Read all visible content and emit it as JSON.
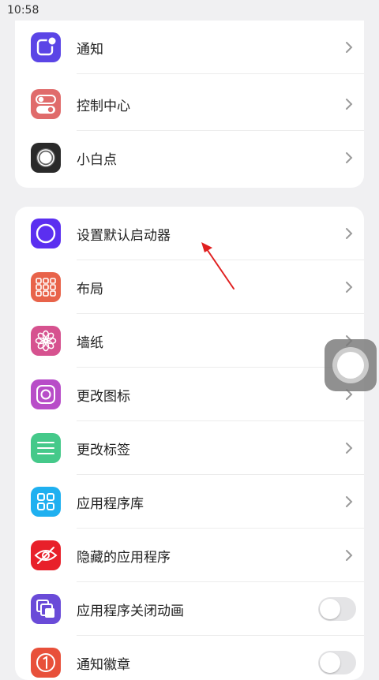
{
  "status_bar": {
    "time": "10:58"
  },
  "section1": {
    "items": [
      {
        "label": "通知",
        "icon": "notification-icon",
        "color": "#5b45e6"
      },
      {
        "label": "控制中心",
        "icon": "toggle-switch-icon",
        "color": "#e06b6b"
      },
      {
        "label": "小白点",
        "icon": "floating-dot-icon",
        "color": "#2a2a2a"
      }
    ]
  },
  "section2": {
    "items": [
      {
        "label": "设置默认启动器",
        "icon": "launcher-circle-icon",
        "color": "#5b2ff0"
      },
      {
        "label": "布局",
        "icon": "grid-layout-icon",
        "color": "#e8634a"
      },
      {
        "label": "墙纸",
        "icon": "flower-icon",
        "color": "#d6528f"
      },
      {
        "label": "更改图标",
        "icon": "change-icon-icon",
        "color": "#b84dc8"
      },
      {
        "label": "更改标签",
        "icon": "lines-icon",
        "color": "#45c98a"
      },
      {
        "label": "应用程序库",
        "icon": "app-library-icon",
        "color": "#1fb0f0"
      },
      {
        "label": "隐藏的应用程序",
        "icon": "eye-hidden-icon",
        "color": "#e8202a"
      },
      {
        "label": "应用程序关闭动画",
        "icon": "close-animation-icon",
        "color": "#6a4bd8",
        "toggle": false
      },
      {
        "label": "通知徽章",
        "icon": "badge-one-icon",
        "color": "#e8503a",
        "toggle": false
      }
    ]
  },
  "annotation": {
    "arrow_color": "#e02020"
  }
}
